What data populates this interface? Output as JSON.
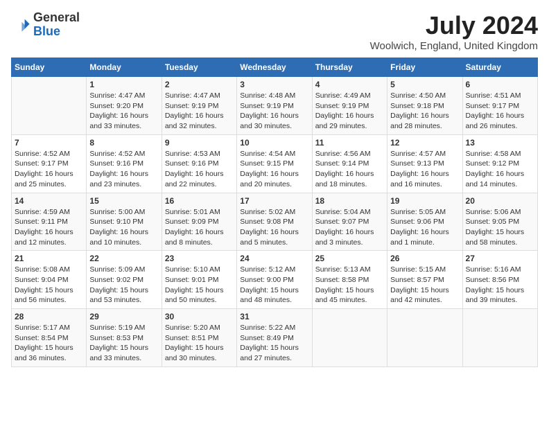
{
  "header": {
    "logo_general": "General",
    "logo_blue": "Blue",
    "month_year": "July 2024",
    "location": "Woolwich, England, United Kingdom"
  },
  "calendar": {
    "days_of_week": [
      "Sunday",
      "Monday",
      "Tuesday",
      "Wednesday",
      "Thursday",
      "Friday",
      "Saturday"
    ],
    "weeks": [
      [
        {
          "day": "",
          "info": ""
        },
        {
          "day": "1",
          "info": "Sunrise: 4:47 AM\nSunset: 9:20 PM\nDaylight: 16 hours\nand 33 minutes."
        },
        {
          "day": "2",
          "info": "Sunrise: 4:47 AM\nSunset: 9:19 PM\nDaylight: 16 hours\nand 32 minutes."
        },
        {
          "day": "3",
          "info": "Sunrise: 4:48 AM\nSunset: 9:19 PM\nDaylight: 16 hours\nand 30 minutes."
        },
        {
          "day": "4",
          "info": "Sunrise: 4:49 AM\nSunset: 9:19 PM\nDaylight: 16 hours\nand 29 minutes."
        },
        {
          "day": "5",
          "info": "Sunrise: 4:50 AM\nSunset: 9:18 PM\nDaylight: 16 hours\nand 28 minutes."
        },
        {
          "day": "6",
          "info": "Sunrise: 4:51 AM\nSunset: 9:17 PM\nDaylight: 16 hours\nand 26 minutes."
        }
      ],
      [
        {
          "day": "7",
          "info": "Sunrise: 4:52 AM\nSunset: 9:17 PM\nDaylight: 16 hours\nand 25 minutes."
        },
        {
          "day": "8",
          "info": "Sunrise: 4:52 AM\nSunset: 9:16 PM\nDaylight: 16 hours\nand 23 minutes."
        },
        {
          "day": "9",
          "info": "Sunrise: 4:53 AM\nSunset: 9:16 PM\nDaylight: 16 hours\nand 22 minutes."
        },
        {
          "day": "10",
          "info": "Sunrise: 4:54 AM\nSunset: 9:15 PM\nDaylight: 16 hours\nand 20 minutes."
        },
        {
          "day": "11",
          "info": "Sunrise: 4:56 AM\nSunset: 9:14 PM\nDaylight: 16 hours\nand 18 minutes."
        },
        {
          "day": "12",
          "info": "Sunrise: 4:57 AM\nSunset: 9:13 PM\nDaylight: 16 hours\nand 16 minutes."
        },
        {
          "day": "13",
          "info": "Sunrise: 4:58 AM\nSunset: 9:12 PM\nDaylight: 16 hours\nand 14 minutes."
        }
      ],
      [
        {
          "day": "14",
          "info": "Sunrise: 4:59 AM\nSunset: 9:11 PM\nDaylight: 16 hours\nand 12 minutes."
        },
        {
          "day": "15",
          "info": "Sunrise: 5:00 AM\nSunset: 9:10 PM\nDaylight: 16 hours\nand 10 minutes."
        },
        {
          "day": "16",
          "info": "Sunrise: 5:01 AM\nSunset: 9:09 PM\nDaylight: 16 hours\nand 8 minutes."
        },
        {
          "day": "17",
          "info": "Sunrise: 5:02 AM\nSunset: 9:08 PM\nDaylight: 16 hours\nand 5 minutes."
        },
        {
          "day": "18",
          "info": "Sunrise: 5:04 AM\nSunset: 9:07 PM\nDaylight: 16 hours\nand 3 minutes."
        },
        {
          "day": "19",
          "info": "Sunrise: 5:05 AM\nSunset: 9:06 PM\nDaylight: 16 hours\nand 1 minute."
        },
        {
          "day": "20",
          "info": "Sunrise: 5:06 AM\nSunset: 9:05 PM\nDaylight: 15 hours\nand 58 minutes."
        }
      ],
      [
        {
          "day": "21",
          "info": "Sunrise: 5:08 AM\nSunset: 9:04 PM\nDaylight: 15 hours\nand 56 minutes."
        },
        {
          "day": "22",
          "info": "Sunrise: 5:09 AM\nSunset: 9:02 PM\nDaylight: 15 hours\nand 53 minutes."
        },
        {
          "day": "23",
          "info": "Sunrise: 5:10 AM\nSunset: 9:01 PM\nDaylight: 15 hours\nand 50 minutes."
        },
        {
          "day": "24",
          "info": "Sunrise: 5:12 AM\nSunset: 9:00 PM\nDaylight: 15 hours\nand 48 minutes."
        },
        {
          "day": "25",
          "info": "Sunrise: 5:13 AM\nSunset: 8:58 PM\nDaylight: 15 hours\nand 45 minutes."
        },
        {
          "day": "26",
          "info": "Sunrise: 5:15 AM\nSunset: 8:57 PM\nDaylight: 15 hours\nand 42 minutes."
        },
        {
          "day": "27",
          "info": "Sunrise: 5:16 AM\nSunset: 8:56 PM\nDaylight: 15 hours\nand 39 minutes."
        }
      ],
      [
        {
          "day": "28",
          "info": "Sunrise: 5:17 AM\nSunset: 8:54 PM\nDaylight: 15 hours\nand 36 minutes."
        },
        {
          "day": "29",
          "info": "Sunrise: 5:19 AM\nSunset: 8:53 PM\nDaylight: 15 hours\nand 33 minutes."
        },
        {
          "day": "30",
          "info": "Sunrise: 5:20 AM\nSunset: 8:51 PM\nDaylight: 15 hours\nand 30 minutes."
        },
        {
          "day": "31",
          "info": "Sunrise: 5:22 AM\nSunset: 8:49 PM\nDaylight: 15 hours\nand 27 minutes."
        },
        {
          "day": "",
          "info": ""
        },
        {
          "day": "",
          "info": ""
        },
        {
          "day": "",
          "info": ""
        }
      ]
    ]
  }
}
